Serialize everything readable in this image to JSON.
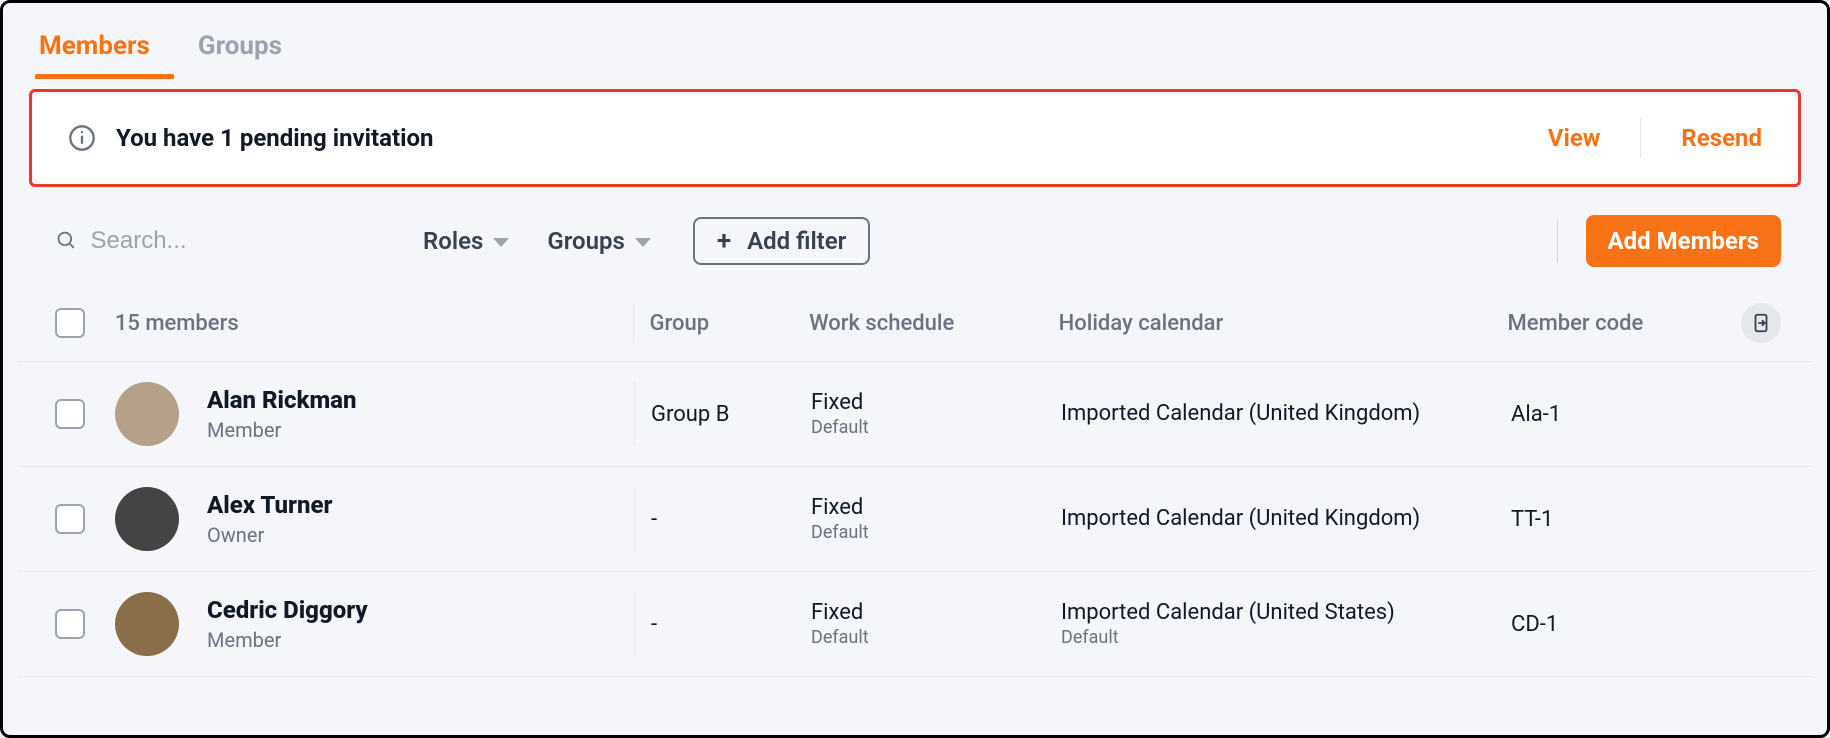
{
  "tabs": {
    "members": "Members",
    "groups": "Groups"
  },
  "alert": {
    "text": "You have 1 pending invitation",
    "view": "View",
    "resend": "Resend"
  },
  "search": {
    "placeholder": "Search..."
  },
  "filters": {
    "roles_label": "Roles",
    "groups_label": "Groups",
    "add_filter_label": "Add filter"
  },
  "add_members_label": "Add Members",
  "table": {
    "count_label": "15 members",
    "headers": {
      "group": "Group",
      "work_schedule": "Work schedule",
      "holiday_calendar": "Holiday calendar",
      "member_code": "Member code"
    },
    "rows": [
      {
        "name": "Alan Rickman",
        "role": "Member",
        "group": "Group B",
        "work_schedule": "Fixed",
        "work_schedule_sub": "Default",
        "holiday_calendar": "Imported Calendar (United Kingdom)",
        "holiday_calendar_sub": "",
        "member_code": "Ala-1",
        "avatar_color": "#b5a18a"
      },
      {
        "name": "Alex Turner",
        "role": "Owner",
        "group": "-",
        "work_schedule": "Fixed",
        "work_schedule_sub": "Default",
        "holiday_calendar": "Imported Calendar (United Kingdom)",
        "holiday_calendar_sub": "",
        "member_code": "TT-1",
        "avatar_color": "#444444"
      },
      {
        "name": "Cedric Diggory",
        "role": "Member",
        "group": "-",
        "work_schedule": "Fixed",
        "work_schedule_sub": "Default",
        "holiday_calendar": "Imported Calendar (United States)",
        "holiday_calendar_sub": "Default",
        "member_code": "CD-1",
        "avatar_color": "#8a6e4a"
      }
    ]
  }
}
